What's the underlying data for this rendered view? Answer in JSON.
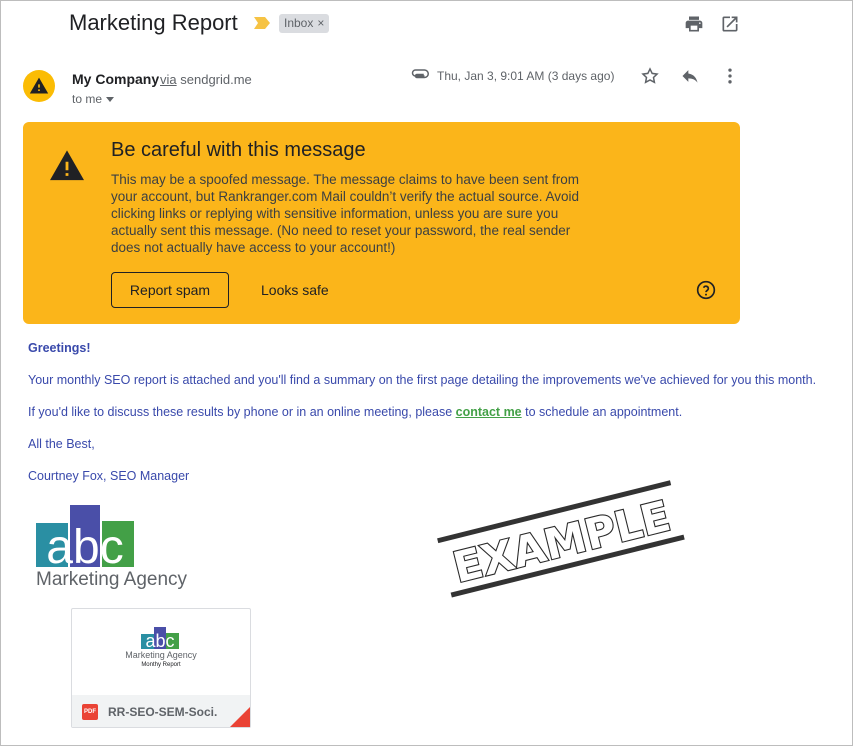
{
  "header": {
    "subject": "Marketing Report",
    "label": "Inbox",
    "label_close": "×",
    "icons": [
      "print-icon",
      "open-in-new-window-icon"
    ]
  },
  "sender": {
    "name": "My Company",
    "via_prefix": "via",
    "via_domain": "sendgrid.me",
    "to": "to me",
    "date": "Thu, Jan 3, 9:01 AM (3 days ago)",
    "icons": [
      "attachment-icon",
      "star-icon",
      "reply-icon",
      "more-options-icon"
    ]
  },
  "warning": {
    "title": "Be careful with this message",
    "body": "This may be a spoofed message. The message claims to have been sent from your account, but Rankranger.com Mail couldn’t verify the actual source. Avoid clicking links or replying with sensitive information, unless you are sure you actually sent this message. (No need to reset your password, the real sender does not actually have access to your account!)",
    "report_spam": "Report spam",
    "looks_safe": "Looks safe",
    "color": "#fbb51a"
  },
  "body": {
    "greeting": "Greetings!",
    "line1": "Your monthly SEO report is attached and you'll find a summary on the first page detailing the improvements we've achieved for you this month.",
    "line2_before": "If you'd like to discuss these results by phone or in an online meeting, please ",
    "line2_link": "contact me",
    "line2_after": " to schedule an appointment.",
    "closing": "All the Best,",
    "signature": "Courtney Fox, SEO Manager",
    "text_color": "#3949ab",
    "link_color": "#43a047"
  },
  "logo": {
    "letters": "abc",
    "caption": "Marketing Agency",
    "colors": [
      "#2a8fa3",
      "#4a4fa8",
      "#43a047"
    ]
  },
  "stamp": {
    "text": "EXAMPLE"
  },
  "attachment": {
    "preview_caption": "Marketing Agency",
    "preview_subcaption": "Monthy Report",
    "badge": "PDF",
    "filename": "RR-SEO-SEM-Soci..."
  }
}
